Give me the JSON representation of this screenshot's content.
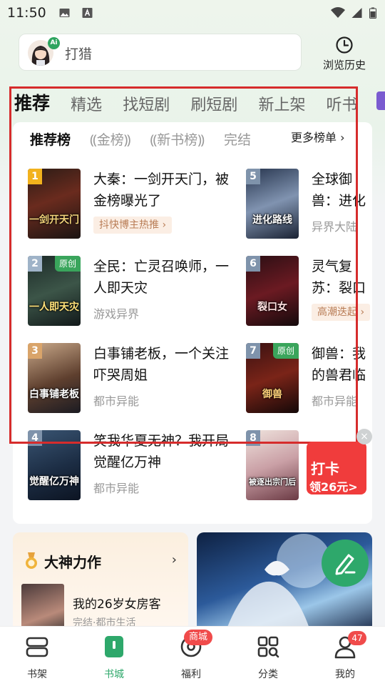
{
  "status_bar": {
    "time": "11:50"
  },
  "search": {
    "placeholder": "打猎",
    "ai_badge": "Ai"
  },
  "history": {
    "label": "浏览历史"
  },
  "tabs": [
    {
      "label": "推荐",
      "active": true
    },
    {
      "label": "精选"
    },
    {
      "label": "找短剧"
    },
    {
      "label": "刷短剧"
    },
    {
      "label": "新上架"
    },
    {
      "label": "听书"
    }
  ],
  "rank_tabs": [
    {
      "label": "推荐榜",
      "active": true
    },
    {
      "label": "金榜"
    },
    {
      "label": "新书榜"
    },
    {
      "label": "完结"
    }
  ],
  "more_rank": "更多榜单",
  "books": [
    {
      "rank": "1",
      "title": "大秦：一剑开天门，被金榜曝光了",
      "tag": "抖快博主热推",
      "cover_text": "一剑开天门"
    },
    {
      "rank": "2",
      "title": "全民：亡灵召唤师，一人即天灾",
      "meta": "游戏异界",
      "badge": "原创",
      "cover_text": "一人即天灾"
    },
    {
      "rank": "3",
      "title": "白事铺老板，一个关注吓哭周姐",
      "meta": "都市异能",
      "cover_text": "白事铺老板"
    },
    {
      "rank": "4",
      "title": "笑我华夏无神？我开局觉醒亿万神",
      "meta": "都市异能",
      "cover_text": "觉醒亿万神"
    },
    {
      "rank": "5",
      "title": "全球御兽：进化路线",
      "meta": "异界大陆",
      "cover_text": "进化路线"
    },
    {
      "rank": "6",
      "title": "灵气复苏：裂口女",
      "tag": "高潮迭起",
      "cover_text": "裂口女"
    },
    {
      "rank": "7",
      "title": "御兽：我的兽君临异界",
      "meta": "都市异能",
      "badge": "原创",
      "cover_text": "御兽"
    },
    {
      "rank": "8",
      "title": "被逐出宗门后",
      "meta": "",
      "cover_text": "被逐出宗门后"
    }
  ],
  "checkin": {
    "line1": "打卡",
    "line2": "领26元>"
  },
  "feature": {
    "title": "大神力作",
    "book_title": "我的26岁女房客",
    "book_meta": "完结·都市生活"
  },
  "bottom_nav": [
    {
      "label": "书架",
      "icon": "bookshelf-icon"
    },
    {
      "label": "书城",
      "icon": "bookstore-icon",
      "active": true
    },
    {
      "label": "福利",
      "icon": "welfare-icon",
      "badge": "商城"
    },
    {
      "label": "分类",
      "icon": "category-icon"
    },
    {
      "label": "我的",
      "icon": "profile-icon",
      "count": "47"
    }
  ],
  "colors": {
    "accent": "#2ea86b",
    "highlight": "#d62c2c",
    "tag_bg": "#fbeee4",
    "tag_fg": "#b97d56"
  }
}
